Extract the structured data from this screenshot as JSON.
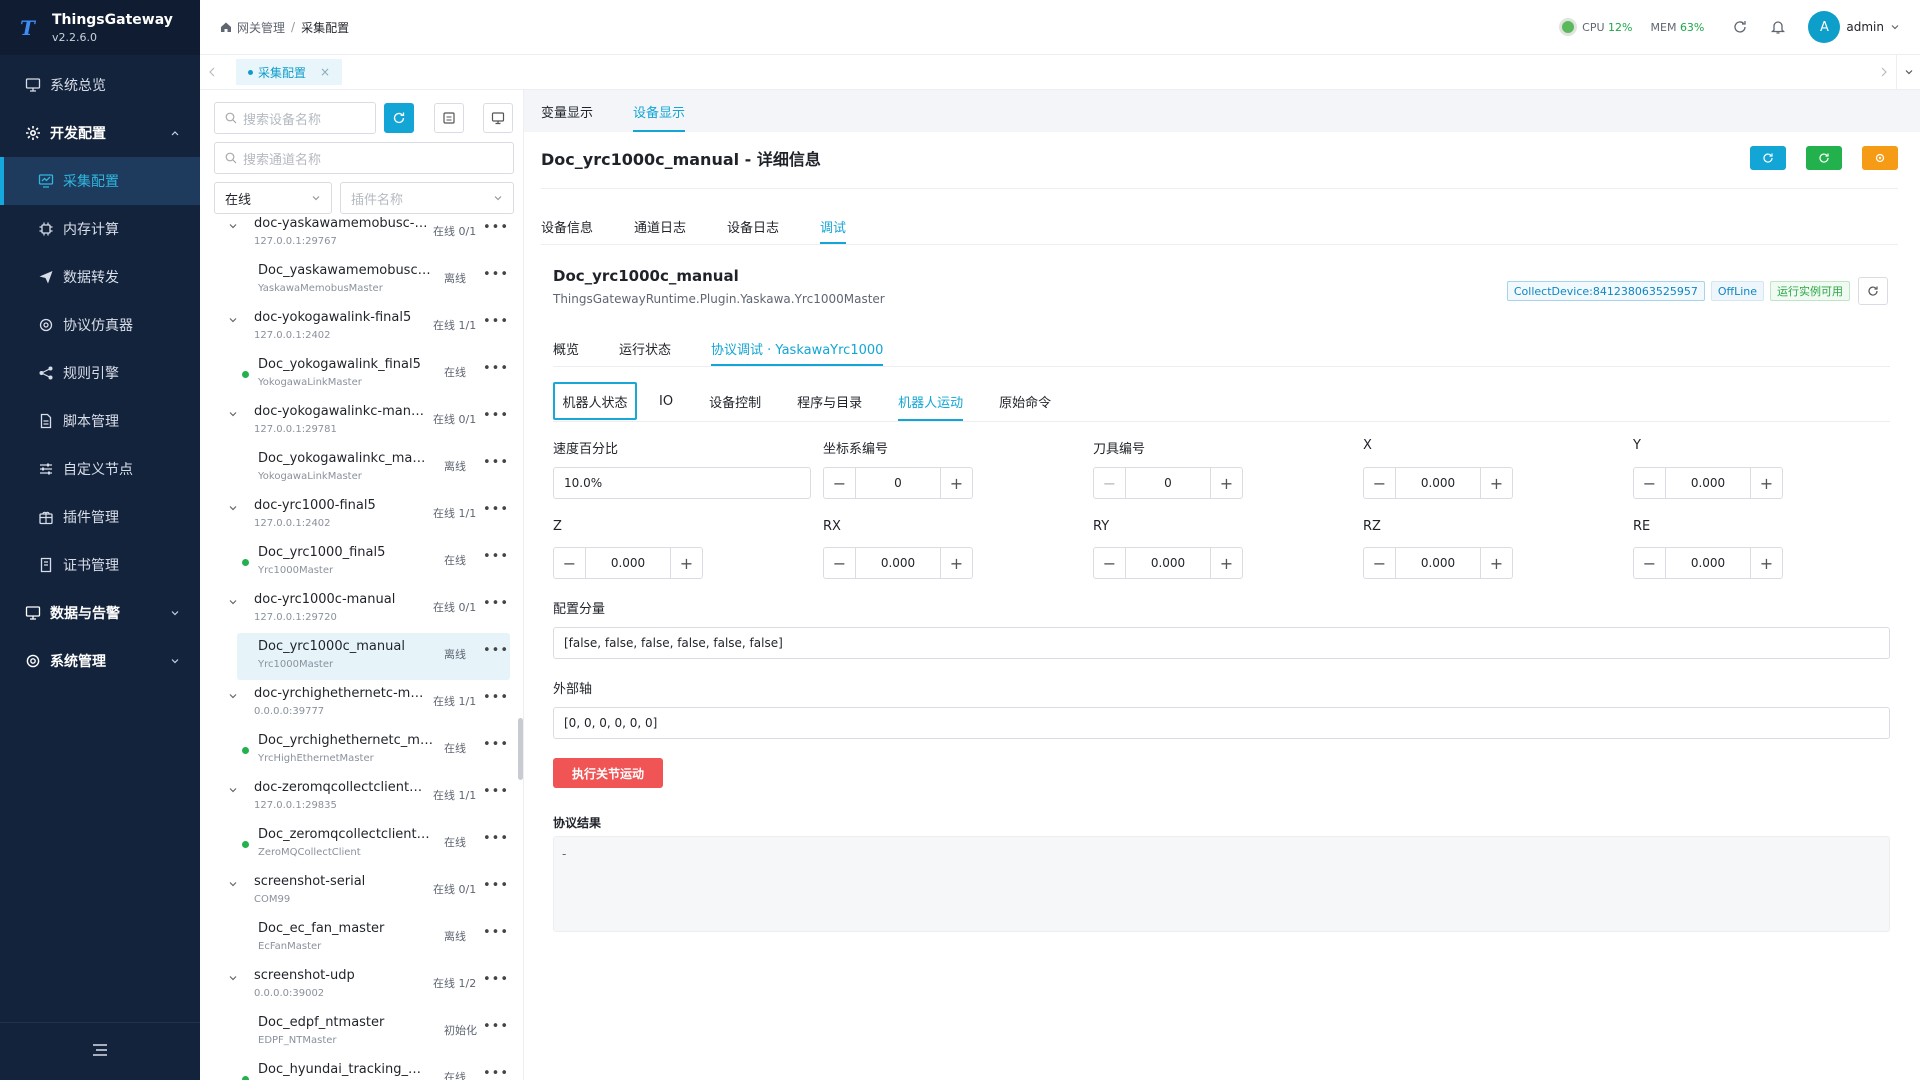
{
  "brand": {
    "title": "ThingsGateway",
    "version": "v2.2.6.0",
    "logo": "T"
  },
  "sidebar": {
    "items": [
      {
        "label": "系统总览",
        "icon": "monitor-icon",
        "type": "top"
      },
      {
        "label": "开发配置",
        "icon": "gear-icon",
        "type": "group"
      },
      {
        "label": "采集配置",
        "icon": "chart-icon",
        "type": "active"
      },
      {
        "label": "内存计算",
        "icon": "chip-icon",
        "type": "sub"
      },
      {
        "label": "数据转发",
        "icon": "send-icon",
        "type": "sub"
      },
      {
        "label": "协议仿真器",
        "icon": "cycle-icon",
        "type": "sub"
      },
      {
        "label": "规则引擎",
        "icon": "share-icon",
        "type": "sub"
      },
      {
        "label": "脚本管理",
        "icon": "file-icon",
        "type": "sub"
      },
      {
        "label": "自定义节点",
        "icon": "sliders-icon",
        "type": "sub"
      },
      {
        "label": "插件管理",
        "icon": "gift-icon",
        "type": "sub"
      },
      {
        "label": "证书管理",
        "icon": "cert-icon",
        "type": "sub"
      },
      {
        "label": "数据与告警",
        "icon": "monitor-icon",
        "type": "top"
      },
      {
        "label": "系统管理",
        "icon": "gear-icon",
        "type": "top"
      }
    ]
  },
  "header": {
    "breadcrumb": [
      "网关管理",
      "采集配置"
    ],
    "cpu_label": "CPU",
    "cpu_value": "12%",
    "mem_label": "MEM",
    "mem_value": "63%",
    "avatar_letter": "A",
    "user": "admin"
  },
  "pagetab": {
    "label": "采集配置",
    "close": "×"
  },
  "devpanel": {
    "search_device_placeholder": "搜索设备名称",
    "search_channel_placeholder": "搜索通道名称",
    "status_select": "在线",
    "plugin_placeholder": "插件名称",
    "tree": [
      {
        "kind": "node",
        "name": "doc-yaskawamemobusc-m...",
        "addr": "127.0.0.1:29767",
        "status": "在线 0/1"
      },
      {
        "kind": "leaf",
        "name": "Doc_yaskawamemobusc_ma...",
        "plugin": "YaskawaMemobusMaster",
        "status": "离线",
        "dot": false
      },
      {
        "kind": "node",
        "name": "doc-yokogawalink-final5",
        "addr": "127.0.0.1:2402",
        "status": "在线 1/1"
      },
      {
        "kind": "leaf",
        "name": "Doc_yokogawalink_final5",
        "plugin": "YokogawaLinkMaster",
        "status": "在线",
        "dot": true
      },
      {
        "kind": "node",
        "name": "doc-yokogawalinkc-manual",
        "addr": "127.0.0.1:29781",
        "status": "在线 0/1"
      },
      {
        "kind": "leaf",
        "name": "Doc_yokogawalinkc_manual",
        "plugin": "YokogawaLinkMaster",
        "status": "离线",
        "dot": false
      },
      {
        "kind": "node",
        "name": "doc-yrc1000-final5",
        "addr": "127.0.0.1:2402",
        "status": "在线 1/1"
      },
      {
        "kind": "leaf",
        "name": "Doc_yrc1000_final5",
        "plugin": "Yrc1000Master",
        "status": "在线",
        "dot": true
      },
      {
        "kind": "node",
        "name": "doc-yrc1000c-manual",
        "addr": "127.0.0.1:29720",
        "status": "在线 0/1"
      },
      {
        "kind": "leaf",
        "name": "Doc_yrc1000c_manual",
        "plugin": "Yrc1000Master",
        "status": "离线",
        "dot": false,
        "selected": true
      },
      {
        "kind": "node",
        "name": "doc-yrchighethernetc-man...",
        "addr": "0.0.0.0:39777",
        "status": "在线 1/1"
      },
      {
        "kind": "leaf",
        "name": "Doc_yrchighethernetc_manual",
        "plugin": "YrcHighEthernetMaster",
        "status": "在线",
        "dot": true
      },
      {
        "kind": "node",
        "name": "doc-zeromqcollectclientfin...",
        "addr": "127.0.0.1:29835",
        "status": "在线 1/1"
      },
      {
        "kind": "leaf",
        "name": "Doc_zeromqcollectclientfinal...",
        "plugin": "ZeroMQCollectClient",
        "status": "在线",
        "dot": true
      },
      {
        "kind": "node",
        "name": "screenshot-serial",
        "addr": "COM99",
        "status": "在线 0/1"
      },
      {
        "kind": "leaf",
        "name": "Doc_ec_fan_master",
        "plugin": "EcFanMaster",
        "status": "离线",
        "dot": false
      },
      {
        "kind": "node",
        "name": "screenshot-udp",
        "addr": "0.0.0.0:39002",
        "status": "在线 1/2"
      },
      {
        "kind": "leaf",
        "name": "Doc_edpf_ntmaster",
        "plugin": "EDPF_NTMaster",
        "status": "初始化",
        "dot": false
      },
      {
        "kind": "leaf",
        "name": "Doc_hyundai_tracking_master",
        "plugin": "",
        "status": "在线",
        "dot": true
      }
    ]
  },
  "main": {
    "top_tabs": [
      "变量显示",
      "设备显示"
    ],
    "detail_title": "Doc_yrc1000c_manual - 详细信息",
    "info_tabs": [
      "设备信息",
      "通道日志",
      "设备日志",
      "调试"
    ],
    "device_name": "Doc_yrc1000c_manual",
    "device_class": "ThingsGatewayRuntime.Plugin.Yaskawa.Yrc1000Master",
    "tag_collect": "CollectDevice:841238063525957",
    "tag_state": "OffLine",
    "tag_running": "运行实例可用",
    "debug_tabs": [
      "概览",
      "运行状态",
      "协议调试 · YaskawaYrc1000"
    ],
    "robot_tabs": [
      "机器人状态",
      "IO",
      "设备控制",
      "程序与目录",
      "机器人运动",
      "原始命令"
    ],
    "fields": {
      "speed_label": "速度百分比",
      "speed_value": "10.0%",
      "coord_label": "坐标系编号",
      "coord_value": "0",
      "tool_label": "刀具编号",
      "tool_value": "0",
      "x_label": "X",
      "x_value": "0.000",
      "y_label": "Y",
      "y_value": "0.000",
      "z_label": "Z",
      "z_value": "0.000",
      "rx_label": "RX",
      "rx_value": "0.000",
      "ry_label": "RY",
      "ry_value": "0.000",
      "rz_label": "RZ",
      "rz_value": "0.000",
      "re_label": "RE",
      "re_value": "0.000",
      "config_label": "配置分量",
      "config_value": "[false, false, false, false, false, false]",
      "ext_label": "外部轴",
      "ext_value": "[0, 0, 0, 0, 0, 0]"
    },
    "run_button": "执行关节运动",
    "result_label": "协议结果",
    "result_value": "-"
  },
  "colors": {
    "accent": "#12a5d6",
    "sidebar": "#14233c",
    "danger": "#f05454",
    "success": "#22b14c",
    "warning": "#f59b16"
  }
}
